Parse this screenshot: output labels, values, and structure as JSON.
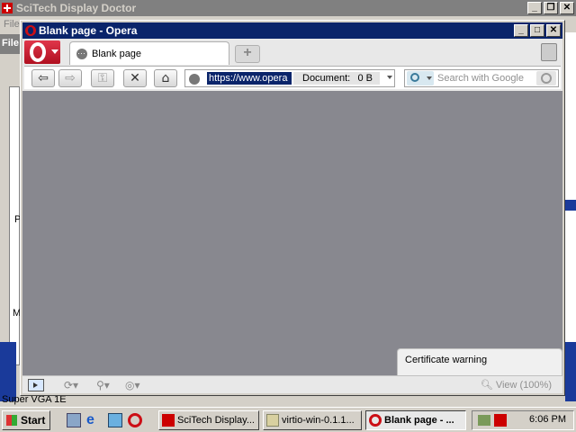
{
  "background_window": {
    "title": "SciTech Display Doctor",
    "menu_first": "File",
    "left_selected_label": "File",
    "left_label_p": "P",
    "left_label_m": "M",
    "status_text": "Super VGA 1E"
  },
  "opera": {
    "window_title": "Blank page - Opera",
    "tab_label": "Blank page",
    "new_tab_symbol": "+",
    "address": {
      "url": "https://www.opera",
      "doc_label": "Document:",
      "doc_size": "0 B"
    },
    "search_placeholder": "Search with Google",
    "cert_warning": "Certificate warning",
    "zoom_label": "View (100%)"
  },
  "taskbar": {
    "start_label": "Start",
    "tasks": [
      {
        "label": "SciTech Display..."
      },
      {
        "label": "virtio-win-0.1.1..."
      },
      {
        "label": "Blank page - ..."
      }
    ],
    "clock": "6:06 PM"
  },
  "colors": {
    "title_active": "#0a246a",
    "title_inactive": "#808080",
    "opera_red": "#cc0f16",
    "content_bg": "#88888f"
  }
}
